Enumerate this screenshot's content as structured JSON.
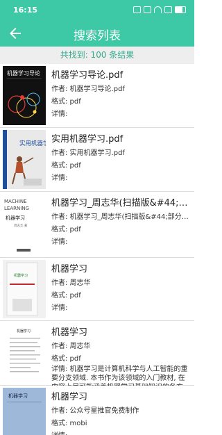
{
  "status_bar": {
    "time": "16:15"
  },
  "header": {
    "title": "搜索列表"
  },
  "result_count": "共找到: 100 条结果",
  "results": [
    {
      "title": "机器学习导论.pdf",
      "author": "作者: 机器学习导论.pdf",
      "format": "格式: pdf",
      "details": "详情:",
      "cover": {
        "bg": "#111111",
        "title": "机器学习导论",
        "accent": "#e53935"
      }
    },
    {
      "title": "实用机器学习.pdf",
      "author": "作者: 实用机器学习.pdf",
      "format": "格式: pdf",
      "details": "详情:",
      "cover": {
        "bg": "#e9e9ea",
        "title": "实用机器学习",
        "accent": "#1f4e9c"
      }
    },
    {
      "title": "机器学习_周志华(扫描版&#44;部分...",
      "author": "作者: 机器学习_周志华(扫描版&#44;部分彩图)...",
      "format": "格式: pdf",
      "details": "详情:",
      "cover": {
        "bg": "#ffffff",
        "line1": "MACHINE",
        "line2": "LEARNING",
        "zh": "机器学习",
        "author": "周志华 著"
      }
    },
    {
      "title": "机器学习",
      "author": "作者: 周志华",
      "format": "格式: pdf",
      "details": "详情:",
      "cover": {
        "bg": "#f1f1f1",
        "title": "机器学习"
      }
    },
    {
      "title": "机器学习",
      "author": "作者: 周志华",
      "format": "格式: pdf",
      "details": "详情: 机器学习是计算机科学与人工智能的重要分支领域. 本书作为该领域的入门教材, 在内容上尽可能涵盖机器学习基础知识的各方面。 为了使...",
      "cover": {
        "bg": "#ffffff",
        "title": "机器学习"
      }
    },
    {
      "title": "机器学习",
      "author": "作者: 公众号星推官免费制作",
      "format": "格式: mobi",
      "details": "详情:",
      "cover": {
        "bg": "#9db8d8",
        "title": "机器学习"
      }
    }
  ]
}
